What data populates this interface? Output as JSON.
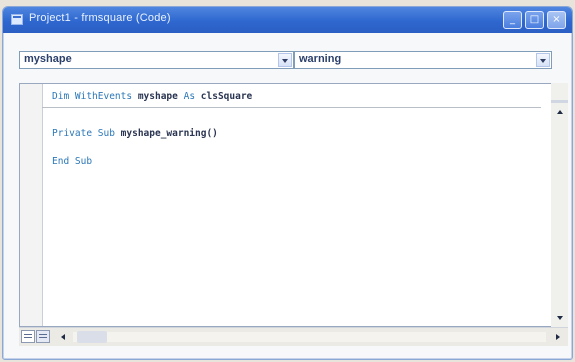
{
  "window": {
    "title": "Project1 - frmsquare (Code)",
    "minimize_icon": "minimize-icon",
    "maximize_icon": "maximize-icon",
    "close_icon": "close-icon"
  },
  "selectors": {
    "object": "myshape",
    "procedure": "warning"
  },
  "code": {
    "line1": {
      "kw1": "Dim WithEvents",
      "name": "myshape",
      "kw2": "As",
      "type": "clsSquare"
    },
    "line2": {
      "kw1": "Private Sub",
      "name": "myshape_warning()"
    },
    "line3": {
      "kw1": "End Sub"
    }
  },
  "colors": {
    "titlebar": "#2e67cf",
    "keyword": "#2b77b8",
    "identifier": "#2a3552"
  }
}
